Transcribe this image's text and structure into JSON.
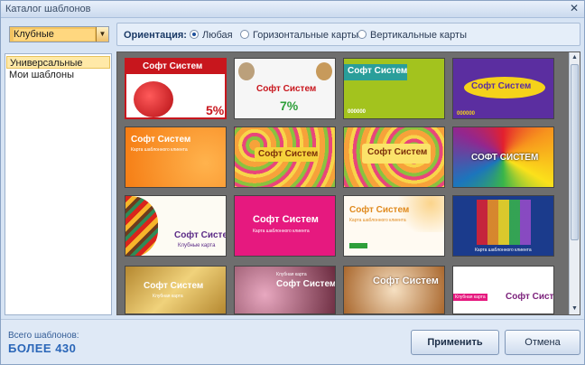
{
  "window": {
    "title": "Каталог шаблонов"
  },
  "category": {
    "selected": "Клубные"
  },
  "templates_list": [
    "Универсальные",
    "Мои шаблоны"
  ],
  "orientation": {
    "label": "Ориентация:",
    "options": [
      "Любая",
      "Горизонтальные карты",
      "Вертикальные карты"
    ],
    "selected": "Любая"
  },
  "cards": {
    "brand": "Софт Систем",
    "brand_caps": "СОФТ СИСТЕМ",
    "subtitle": "Карта шаблонного клиента",
    "club_card": "Клубные карта",
    "club_card2": "Клубная карта",
    "percent5": "5%",
    "percent7": "7%",
    "code": "000000"
  },
  "footer": {
    "count_label": "Всего шаблонов:",
    "count_value": "БОЛЕЕ 430",
    "apply": "Применить",
    "cancel": "Отмена"
  }
}
